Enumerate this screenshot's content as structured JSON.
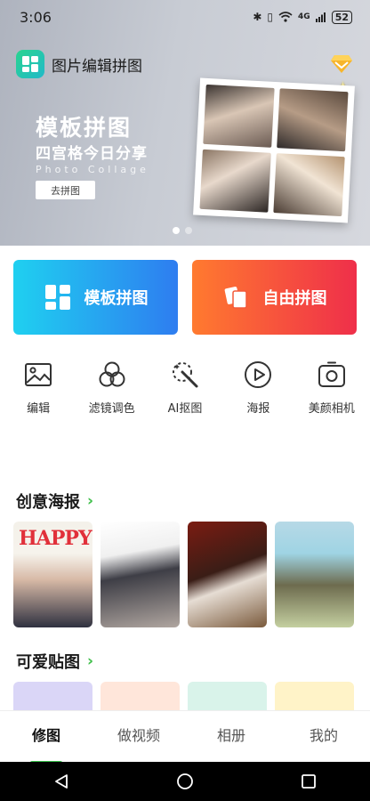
{
  "status_bar": {
    "time": "3:06",
    "network": "4G",
    "battery": "52"
  },
  "app": {
    "title": "图片编辑拼图"
  },
  "banner": {
    "title": "模板拼图",
    "subtitle": "四宫格今日分享",
    "english": "Photo Collage",
    "button": "去拼图",
    "dots_count": 2,
    "active_dot": 1
  },
  "main_buttons": {
    "template": "模板拼图",
    "free": "自由拼图"
  },
  "tools": [
    {
      "label": "编辑",
      "icon": "image-icon"
    },
    {
      "label": "滤镜调色",
      "icon": "filter-circles-icon"
    },
    {
      "label": "AI抠图",
      "icon": "magic-wand-icon"
    },
    {
      "label": "海报",
      "icon": "play-circle-icon"
    },
    {
      "label": "美颜相机",
      "icon": "camera-icon"
    }
  ],
  "sections": {
    "posters": "创意海报",
    "stickers": "可爱贴图"
  },
  "poster_texts": {
    "happy": "HAPPY"
  },
  "tabs": [
    {
      "label": "修图",
      "active": true
    },
    {
      "label": "做视频",
      "active": false
    },
    {
      "label": "相册",
      "active": false
    },
    {
      "label": "我的",
      "active": false
    }
  ],
  "colors": {
    "accent_green": "#39c14b",
    "template_gradient": [
      "#1fd0f0",
      "#2e7df0"
    ],
    "free_gradient": [
      "#ff7a2f",
      "#ef2f4a"
    ]
  }
}
